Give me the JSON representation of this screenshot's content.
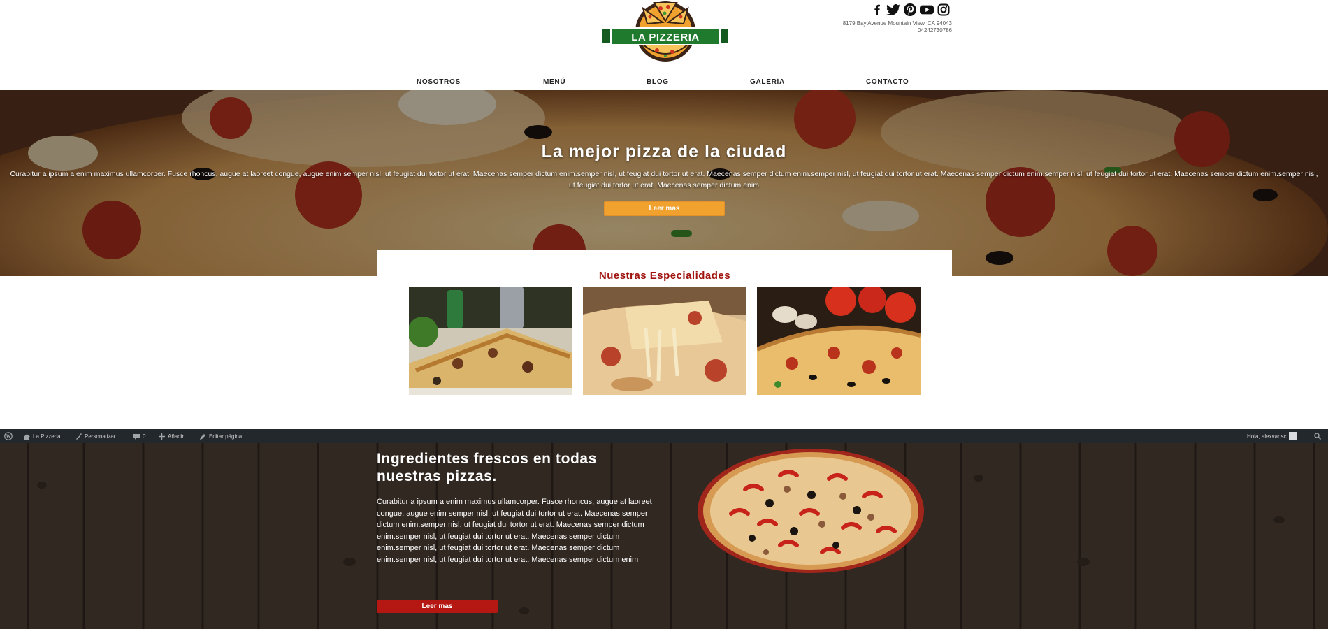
{
  "header": {
    "logo_text": "LA PIZZERIA",
    "address": "8179 Bay Avenue Mountain View, CA 94043",
    "phone": "04242730786",
    "social_icons": [
      "facebook-icon",
      "twitter-icon",
      "pinterest-icon",
      "youtube-icon",
      "instagram-icon"
    ]
  },
  "nav": {
    "items": [
      {
        "label": "NOSOTROS"
      },
      {
        "label": "MENÚ"
      },
      {
        "label": "BLOG"
      },
      {
        "label": "GALERÍA"
      },
      {
        "label": "CONTACTO"
      }
    ]
  },
  "hero": {
    "title": "La mejor pizza de la ciudad",
    "text": "Curabitur a ipsum a enim maximus ullamcorper. Fusce rhoncus, augue at laoreet congue, augue enim semper nisl, ut feugiat dui tortor ut erat. Maecenas semper dictum enim.semper nisl, ut feugiat dui tortor ut erat. Maecenas semper dictum enim.semper nisl, ut feugiat dui tortor ut erat. Maecenas semper dictum enim.semper nisl, ut feugiat dui tortor ut erat. Maecenas semper dictum enim.semper nisl, ut feugiat dui tortor ut erat. Maecenas semper dictum enim",
    "button_label": "Leer mas"
  },
  "specials": {
    "title": "Nuestras Especialidades",
    "items": [
      "pizza-slice-photo",
      "cheese-pull-photo",
      "pepperoni-pizza-photo"
    ]
  },
  "admin_bar": {
    "site_name": "La Pizzeria",
    "customize": "Personalizar",
    "comments_count": "0",
    "add_new": "Añadir",
    "edit_page": "Editar página",
    "greeting": "Hola, alexvarisc"
  },
  "ingredients": {
    "title": "Ingredientes frescos en todas nuestras pizzas.",
    "text": "Curabitur a ipsum a enim maximus ullamcorper. Fusce rhoncus, augue at laoreet congue, augue enim semper nisl, ut feugiat dui tortor ut erat. Maecenas semper dictum enim.semper nisl, ut feugiat dui tortor ut erat. Maecenas semper dictum enim.semper nisl, ut feugiat dui tortor ut erat. Maecenas semper dictum enim.semper nisl, ut feugiat dui tortor ut erat. Maecenas semper dictum enim.semper nisl, ut feugiat dui tortor ut erat. Maecenas semper dictum enim",
    "button_label": "Leer mas"
  },
  "colors": {
    "accent_orange": "#f0a12e",
    "brand_red": "#a01410",
    "button_red": "#b51812",
    "admin_bar": "#23282d",
    "logo_green": "#1f7a2e"
  }
}
